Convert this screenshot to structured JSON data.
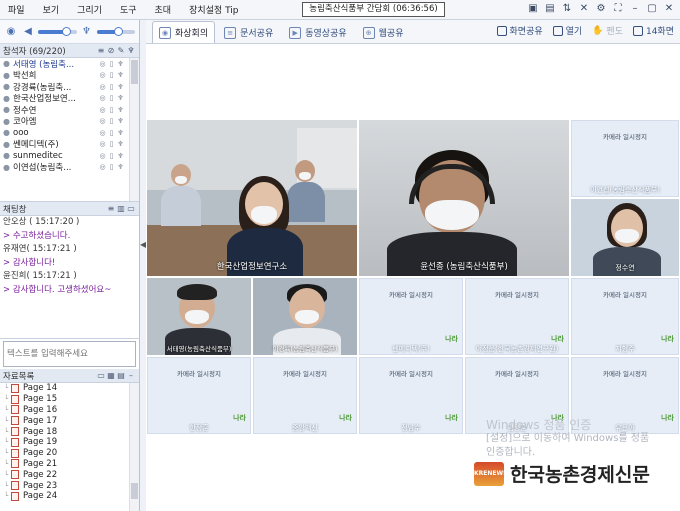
{
  "menu": [
    "파일",
    "보기",
    "그리기",
    "도구",
    "초대",
    "장치설정 Tip"
  ],
  "window_title": "농림축산식품부 간담회 (06:36:56)",
  "audio": {
    "speaker_level": 0.72,
    "mic_level": 0.55
  },
  "participants": {
    "header": "참석자 (69/220)",
    "items": [
      {
        "name": "서태영 (농림축..."
      },
      {
        "name": "박선희"
      },
      {
        "name": "강경륙(농림축..."
      },
      {
        "name": "한국산업정보연..."
      },
      {
        "name": "정수연"
      },
      {
        "name": "코아엠"
      },
      {
        "name": "ooo"
      },
      {
        "name": "쎈메디텍(주)"
      },
      {
        "name": "sunmeditec"
      },
      {
        "name": "이연섭(농림축..."
      }
    ]
  },
  "chat": {
    "header": "채팅창",
    "lines": [
      {
        "kind": "sender",
        "text": "안오상 ( 15:17:20 )"
      },
      {
        "kind": "msg",
        "text": "> 수고하셨습니다."
      },
      {
        "kind": "sender",
        "text": "유재연( 15:17:21 )"
      },
      {
        "kind": "msg",
        "text": "> 감사합니다!"
      },
      {
        "kind": "sender",
        "text": "윤진희( 15:17:21 )"
      },
      {
        "kind": "msg",
        "text": "> 감사합니다. 고생하셨어요~"
      }
    ],
    "input_placeholder": "텍스트를 입력해주세요"
  },
  "materials": {
    "header": "자료목록",
    "pages": [
      "Page 14",
      "Page 15",
      "Page 16",
      "Page 17",
      "Page 18",
      "Page 19",
      "Page 20",
      "Page 21",
      "Page 22",
      "Page 23",
      "Page 24"
    ]
  },
  "tabs": [
    {
      "label": "화상회의",
      "active": true
    },
    {
      "label": "문서공유",
      "active": false
    },
    {
      "label": "동영상공유",
      "active": false
    },
    {
      "label": "웹공유",
      "active": false
    }
  ],
  "toolbar": {
    "screen_share": "화면공유",
    "open": "열기",
    "pen": "펜도",
    "layout": "14화면"
  },
  "videos": {
    "main1": "한국산업정보연구소",
    "main2": "윤선종 (농림축산식품부)",
    "small1": "이연섭(농림축산식품부)",
    "small2": "정수연",
    "small3": "서태영(농림축산식품부)",
    "small4": "이경륙(농림축산식품부)",
    "placeholder_text": "카메라 일시정지",
    "brand": "나라",
    "ph": [
      {
        "name": "쎈메디텍(주)"
      },
      {
        "name": "이정운(한국농촌경제연구원)"
      },
      {
        "name": "지형주"
      },
      {
        "name": "한정훈"
      },
      {
        "name": "중앙백신"
      },
      {
        "name": "정남수"
      },
      {
        "name": "김정훈"
      },
      {
        "name": "유은아"
      }
    ]
  },
  "watermark": {
    "line1": "Windows 정품 인증",
    "line2": "[설정]으로 이동하여 Windows를 정품",
    "line3": "인증합니다."
  },
  "logo": {
    "badge": "KRENEWS",
    "text": "한국농촌경제신문"
  },
  "colors": {
    "accent": "#4b7bd0",
    "chat_msg": "#7a1f9c",
    "bg": "#eef2f8"
  }
}
